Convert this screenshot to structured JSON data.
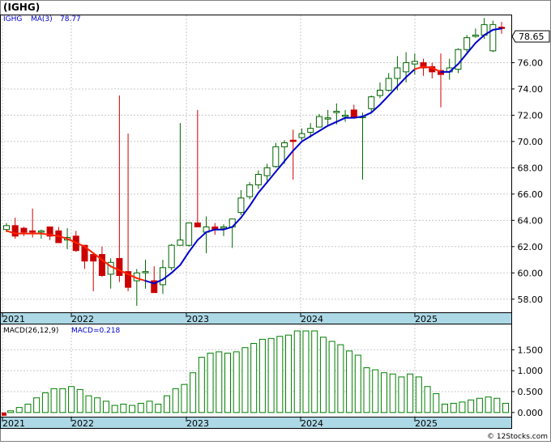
{
  "header": {
    "title": "(IGHG)",
    "ticker_label": "IGHG",
    "ma_label": "MA(3)",
    "ma_value": "78.77",
    "last_price_tag": "78.65"
  },
  "macd_header": {
    "label": "MACD(26,12,9)",
    "value_label": "MACD=0.218"
  },
  "footer": {
    "credit": "© 12Stocks.com"
  },
  "colors": {
    "up_candle": "#006400",
    "down_candle": "#cc0000",
    "ma_rising": "#0000cc",
    "ma_falling": "#ff2200",
    "axis_band": "#add8e6",
    "macd_bar": "#008000"
  },
  "chart_data": [
    {
      "type": "candlestick",
      "title": "(IGHG)",
      "xlabel": "",
      "ylabel": "",
      "x_tick_labels": [
        "2021",
        "2022",
        "2023",
        "2024",
        "2025"
      ],
      "y_ticks": [
        58,
        60,
        62,
        64,
        66,
        68,
        70,
        72,
        74,
        76
      ],
      "ylim": [
        57.0,
        79.6
      ],
      "grid": true,
      "series": [
        {
          "name": "IGHG",
          "candles": [
            [
              63.3,
              63.8,
              63.1,
              63.6
            ],
            [
              63.6,
              64.2,
              62.6,
              62.8
            ],
            [
              63.4,
              63.5,
              62.8,
              63.1
            ],
            [
              63.2,
              64.9,
              62.7,
              63.1
            ],
            [
              63.1,
              63.3,
              62.6,
              63.2
            ],
            [
              63.5,
              63.5,
              62.5,
              62.8
            ],
            [
              63.2,
              63.5,
              62.3,
              62.3
            ],
            [
              62.5,
              63.4,
              61.8,
              62.7
            ],
            [
              62.8,
              63.2,
              61.6,
              61.7
            ],
            [
              62.1,
              62.1,
              60.3,
              60.9
            ],
            [
              61.4,
              61.5,
              58.6,
              60.9
            ],
            [
              61.4,
              62.0,
              59.7,
              59.8
            ],
            [
              59.9,
              61.1,
              58.8,
              60.8
            ],
            [
              61.1,
              73.5,
              59.3,
              59.8
            ],
            [
              60.1,
              70.6,
              58.6,
              58.9
            ],
            [
              59.4,
              60.3,
              57.5,
              60.0
            ],
            [
              60.1,
              61.0,
              58.8,
              60.1
            ],
            [
              59.4,
              60.5,
              58.6,
              58.5
            ],
            [
              59.1,
              61.0,
              58.4,
              60.4
            ],
            [
              60.4,
              62.2,
              60.2,
              62.1
            ],
            [
              62.1,
              71.4,
              62.2,
              62.5
            ],
            [
              62.1,
              63.8,
              62.0,
              63.8
            ],
            [
              63.8,
              72.4,
              63.5,
              63.5
            ],
            [
              63.1,
              64.3,
              61.5,
              63.5
            ],
            [
              63.5,
              63.8,
              62.9,
              63.3
            ],
            [
              63.4,
              63.7,
              62.8,
              63.5
            ],
            [
              63.5,
              63.8,
              61.9,
              64.1
            ],
            [
              64.6,
              66.3,
              64.4,
              65.7
            ],
            [
              65.8,
              66.9,
              65.6,
              66.7
            ],
            [
              66.7,
              67.8,
              66.4,
              67.5
            ],
            [
              67.4,
              68.3,
              67.0,
              68.0
            ],
            [
              68.1,
              69.9,
              68.0,
              69.6
            ],
            [
              69.6,
              70.1,
              68.3,
              69.9
            ],
            [
              70.1,
              70.9,
              67.1,
              70.0
            ],
            [
              70.3,
              71.0,
              70.1,
              70.6
            ],
            [
              70.7,
              71.4,
              70.3,
              71.0
            ],
            [
              71.1,
              72.1,
              71.1,
              71.9
            ],
            [
              71.8,
              72.4,
              71.2,
              71.8
            ],
            [
              72.2,
              72.9,
              71.3,
              72.3
            ],
            [
              71.9,
              72.4,
              71.5,
              72.0
            ],
            [
              72.4,
              72.8,
              71.9,
              71.8
            ],
            [
              71.9,
              72.2,
              67.1,
              71.9
            ],
            [
              72.5,
              73.5,
              72.2,
              73.4
            ],
            [
              73.5,
              74.5,
              73.3,
              73.9
            ],
            [
              73.9,
              75.2,
              73.8,
              74.8
            ],
            [
              74.8,
              76.5,
              73.9,
              75.6
            ],
            [
              75.3,
              76.8,
              74.5,
              76.0
            ],
            [
              75.9,
              76.7,
              75.1,
              76.1
            ],
            [
              76.0,
              76.3,
              75.0,
              75.6
            ],
            [
              75.7,
              76.0,
              74.8,
              75.3
            ],
            [
              75.4,
              76.7,
              72.6,
              75.1
            ],
            [
              75.3,
              76.3,
              74.7,
              75.6
            ],
            [
              75.5,
              77.1,
              75.2,
              77.0
            ],
            [
              77.0,
              78.1,
              76.8,
              77.9
            ],
            [
              78.0,
              78.6,
              77.9,
              78.1
            ],
            [
              78.1,
              79.4,
              77.8,
              78.9
            ],
            [
              76.9,
              79.2,
              76.8,
              78.9
            ],
            [
              78.7,
              79.1,
              78.2,
              78.6
            ]
          ]
        },
        {
          "name": "MA(3)",
          "values": [
            63.2,
            63.0,
            63.0,
            63.0,
            63.0,
            62.9,
            62.8,
            62.6,
            62.3,
            62.0,
            61.5,
            61.0,
            60.5,
            60.2,
            59.9,
            59.6,
            59.4,
            59.2,
            59.5,
            60.0,
            60.6,
            61.6,
            62.5,
            63.1,
            63.3,
            63.3,
            63.5,
            64.2,
            65.1,
            66.1,
            66.9,
            67.7,
            68.5,
            69.3,
            70.0,
            70.4,
            70.8,
            71.2,
            71.5,
            71.8,
            71.8,
            71.9,
            72.2,
            72.8,
            73.5,
            74.2,
            74.9,
            75.5,
            75.7,
            75.6,
            75.3,
            75.3,
            75.9,
            76.7,
            77.5,
            78.1,
            78.5,
            78.6
          ]
        }
      ]
    },
    {
      "type": "bar",
      "title": "MACD(26,12,9)",
      "x_tick_labels": [
        "2021",
        "2022",
        "2023",
        "2024",
        "2025"
      ],
      "y_ticks": [
        0.0,
        0.5,
        1.0,
        1.5
      ],
      "y_tick_labels": [
        "0.000",
        "0.500",
        "1.000",
        "1.500"
      ],
      "ylim": [
        -0.1,
        1.95
      ],
      "series": [
        {
          "name": "MACD",
          "values": [
            0.04,
            0.12,
            0.2,
            0.35,
            0.47,
            0.57,
            0.57,
            0.62,
            0.55,
            0.4,
            0.35,
            0.27,
            0.17,
            0.2,
            0.17,
            0.22,
            0.27,
            0.2,
            0.4,
            0.57,
            0.67,
            0.95,
            1.32,
            1.42,
            1.45,
            1.42,
            1.45,
            1.55,
            1.65,
            1.75,
            1.77,
            1.82,
            1.85,
            1.95,
            1.95,
            1.95,
            1.8,
            1.7,
            1.62,
            1.47,
            1.37,
            1.07,
            1.02,
            0.95,
            0.92,
            0.85,
            0.92,
            0.85,
            0.62,
            0.45,
            0.2,
            0.22,
            0.25,
            0.3,
            0.34,
            0.37,
            0.34,
            0.22
          ],
          "extra": {
            "first_bar_color": "#cc0000",
            "first_bar_value": -0.1
          }
        }
      ]
    }
  ]
}
